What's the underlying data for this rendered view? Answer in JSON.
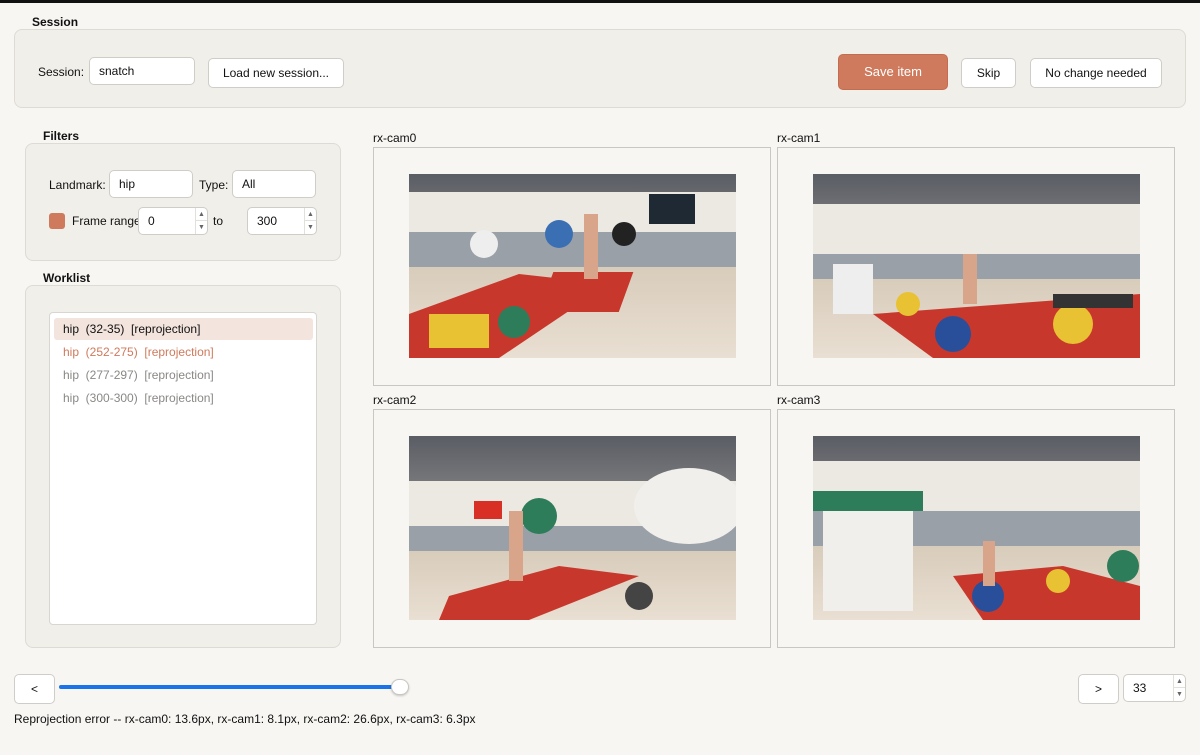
{
  "session": {
    "section_title": "Session",
    "label": "Session:",
    "value": "snatch",
    "load_button": "Load new session...",
    "save_button": "Save item",
    "skip_button": "Skip",
    "no_change_button": "No change needed"
  },
  "filters": {
    "section_title": "Filters",
    "landmark_label": "Landmark:",
    "landmark_value": "hip",
    "type_label": "Type:",
    "type_value": "All",
    "frame_range_label": "Frame range",
    "range_from": "0",
    "range_to_label": "to",
    "range_to": "300",
    "swatch_color": "#cf7a5d"
  },
  "worklist": {
    "section_title": "Worklist",
    "items": [
      {
        "text": "hip  (32-35)  [reprojection]",
        "state": "selected"
      },
      {
        "text": "hip  (252-275)  [reprojection]",
        "state": "active"
      },
      {
        "text": "hip  (277-297)  [reprojection]",
        "state": "dim"
      },
      {
        "text": "hip  (300-300)  [reprojection]",
        "state": "dim"
      }
    ]
  },
  "cameras": [
    {
      "name": "rx-cam0"
    },
    {
      "name": "rx-cam1"
    },
    {
      "name": "rx-cam2"
    },
    {
      "name": "rx-cam3"
    }
  ],
  "navigation": {
    "prev_button": "<",
    "next_button": ">",
    "frame_value": "33",
    "slider_fraction": 1.0,
    "slider_color": "#1a73e8"
  },
  "status": {
    "reprojection_text": "Reprojection error -- rx-cam0: 13.6px, rx-cam1: 8.1px, rx-cam2: 26.6px, rx-cam3: 6.3px"
  },
  "colors": {
    "accent": "#cf7a5d",
    "background": "#f7f6f3"
  }
}
